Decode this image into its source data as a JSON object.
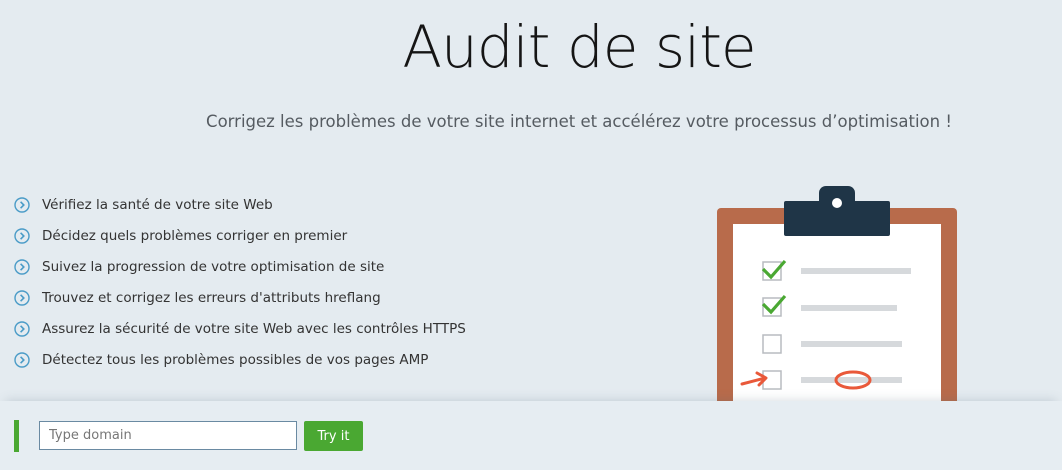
{
  "header": {
    "title": "Audit de site",
    "subtitle": "Corrigez les problèmes de votre site internet et accélérez votre processus d’optimisation !"
  },
  "features": [
    "Vérifiez la santé de votre site Web",
    "Décidez quels problèmes corriger en premier",
    "Suivez la progression de votre optimisation de site",
    "Trouvez et corrigez les erreurs d'attributs hreflang",
    "Assurez la sécurité de votre site Web avec les contrôles HTTPS",
    "Détectez tous les problèmes possibles de vos pages AMP"
  ],
  "form": {
    "placeholder": "Type domain",
    "button_label": "Try it"
  },
  "icons": {
    "bullet": "chevron-right-circle-icon",
    "illustration": "clipboard-checklist-icon"
  },
  "colors": {
    "accent": "#4aa832",
    "bullet": "#4a9bc7",
    "clipboard_frame": "#b86b4b",
    "clipboard_clip": "#1f3547",
    "mark_red": "#e9593a"
  },
  "checklist": [
    {
      "state": "checked"
    },
    {
      "state": "checked"
    },
    {
      "state": "unchecked"
    },
    {
      "state": "unchecked",
      "highlighted": true
    }
  ]
}
